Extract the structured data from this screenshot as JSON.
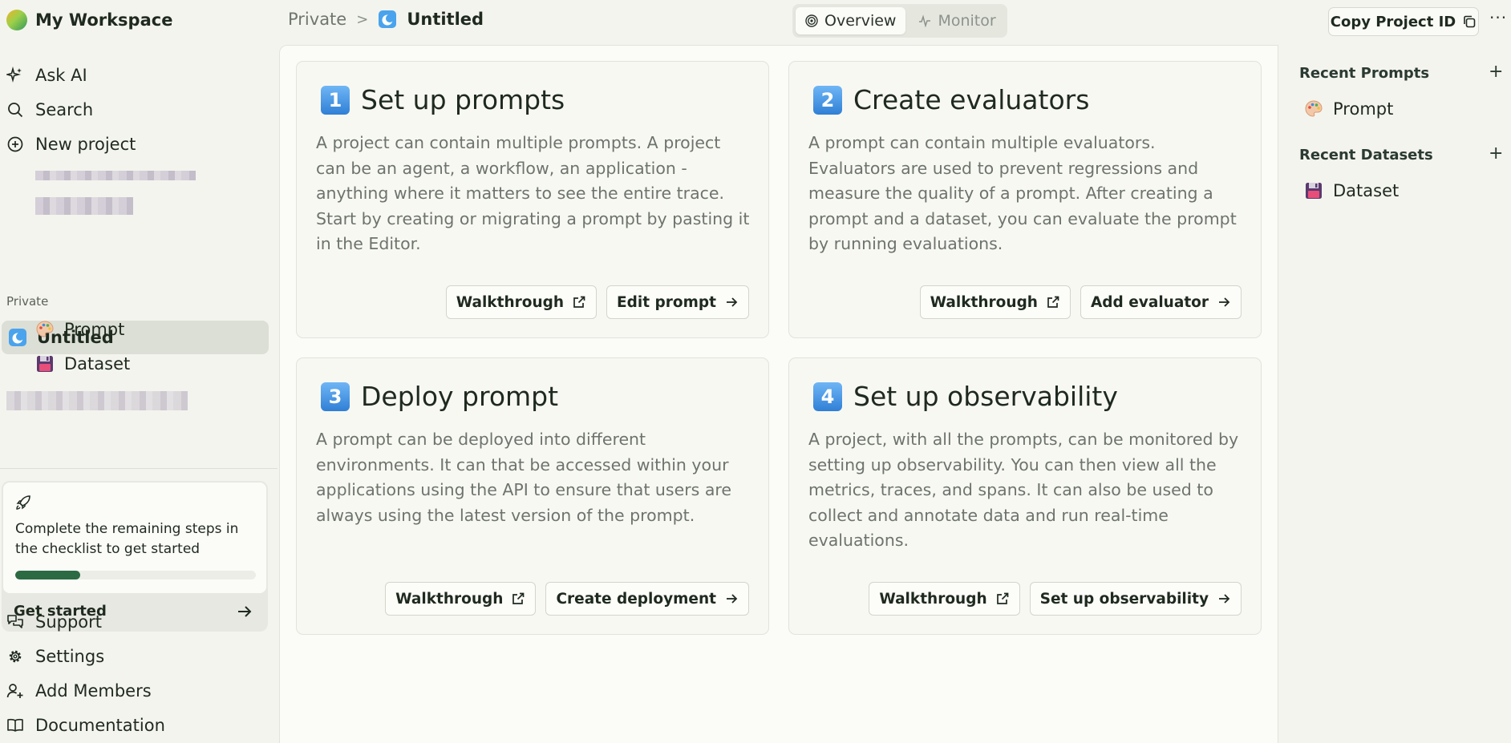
{
  "workspace": {
    "name": "My Workspace"
  },
  "breadcrumb": {
    "parent": "Private",
    "separator": ">",
    "current": "Untitled"
  },
  "tabs": [
    {
      "label": "Overview",
      "icon": "target-icon",
      "active": true
    },
    {
      "label": "Monitor",
      "icon": "activity-icon",
      "active": false
    }
  ],
  "header": {
    "copy_label": "Copy Project ID",
    "more_label": "···"
  },
  "sidebar": {
    "top_items": [
      {
        "label": "Ask AI",
        "icon": "sparkle-icon"
      },
      {
        "label": "Search",
        "icon": "search-icon"
      },
      {
        "label": "New project",
        "icon": "plus-circle-icon"
      }
    ],
    "section_label": "Private",
    "project": {
      "label": "Untitled",
      "icon": "project-icon"
    },
    "children": [
      {
        "label": "Prompt",
        "icon": "palette-icon"
      },
      {
        "label": "Dataset",
        "icon": "floppy-icon"
      }
    ],
    "checklist": {
      "text": "Complete the remaining steps in the checklist to get started",
      "progress": 0.27,
      "cta": "Get started"
    },
    "bottom_items": [
      {
        "label": "Support",
        "icon": "chat-icon"
      },
      {
        "label": "Settings",
        "icon": "gear-icon"
      },
      {
        "label": "Add Members",
        "icon": "user-plus-icon"
      },
      {
        "label": "Documentation",
        "icon": "book-icon"
      }
    ]
  },
  "cards": [
    {
      "num": "1",
      "title": "Set up prompts",
      "desc": "A project can contain multiple prompts. A project can be an agent, a workflow, an application - anything where it matters to see the entire trace. Start by creating or migrating a prompt by pasting it in the Editor.",
      "btn1": "Walkthrough",
      "btn2": "Edit prompt"
    },
    {
      "num": "2",
      "title": "Create evaluators",
      "desc": "A prompt can contain multiple evaluators. Evaluators are used to prevent regressions and measure the quality of a prompt. After creating a prompt and a dataset, you can evaluate the prompt by running evaluations.",
      "btn1": "Walkthrough",
      "btn2": "Add evaluator"
    },
    {
      "num": "3",
      "title": "Deploy prompt",
      "desc": "A prompt can be deployed into different environments. It can that be accessed within your applications using the API to ensure that users are always using the latest version of the prompt.",
      "btn1": "Walkthrough",
      "btn2": "Create deployment"
    },
    {
      "num": "4",
      "title": "Set up observability",
      "desc": "A project, with all the prompts, can be monitored by setting up observability. You can then view all the metrics, traces, and spans. It can also be used to collect and annotate data and run real-time evaluations.",
      "btn1": "Walkthrough",
      "btn2": "Set up observability"
    }
  ],
  "right_panel": {
    "recent_prompts": {
      "title": "Recent Prompts",
      "plus": "+",
      "items": [
        {
          "label": "Prompt",
          "icon": "palette-icon"
        }
      ]
    },
    "recent_datasets": {
      "title": "Recent Datasets",
      "plus": "+",
      "items": [
        {
          "label": "Dataset",
          "icon": "floppy-icon"
        }
      ]
    }
  },
  "colors": {
    "accent": "#2b6a43",
    "number_badge": "#3d8fe0",
    "background": "#f4f4ee"
  }
}
